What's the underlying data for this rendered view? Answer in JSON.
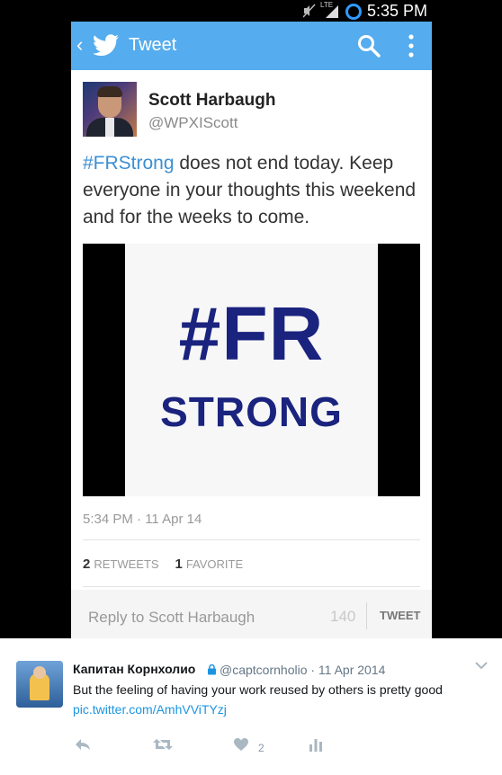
{
  "status_bar": {
    "time": "5:35 PM",
    "network": "LTE"
  },
  "app_bar": {
    "title": "Tweet",
    "icons": [
      "back-icon",
      "twitter-bird-icon",
      "search-icon",
      "more-vertical-icon"
    ]
  },
  "tweet": {
    "author_name": "Scott Harbaugh",
    "author_handle": "@WPXIScott",
    "hashtag": "#FRStrong",
    "text_rest": " does not end today.  Keep everyone in your thoughts this weekend and for the weeks to come.",
    "image_big": "#FR",
    "image_small": "STRONG",
    "timestamp": "5:34 PM · 11 Apr 14",
    "retweets_count": "2",
    "retweets_label": "RETWEETS",
    "favorites_count": "1",
    "favorites_label": "FAVORITE"
  },
  "reply_bar": {
    "placeholder": "Reply to Scott Harbaugh",
    "char_count": "140",
    "button": "TWEET"
  },
  "embedded_post": {
    "display_name": "Капитан Корнхолио",
    "handle_date": "@captcornholio · 11 Apr 2014",
    "text": "But the feeling of having your work reused by others is pretty good",
    "link": "pic.twitter.com/AmhVViTYzj",
    "like_count": "2"
  },
  "colors": {
    "accent": "#55acee",
    "hashtag": "#3b8fd3",
    "image_text": "#1a237e",
    "link": "#1b95e0"
  }
}
